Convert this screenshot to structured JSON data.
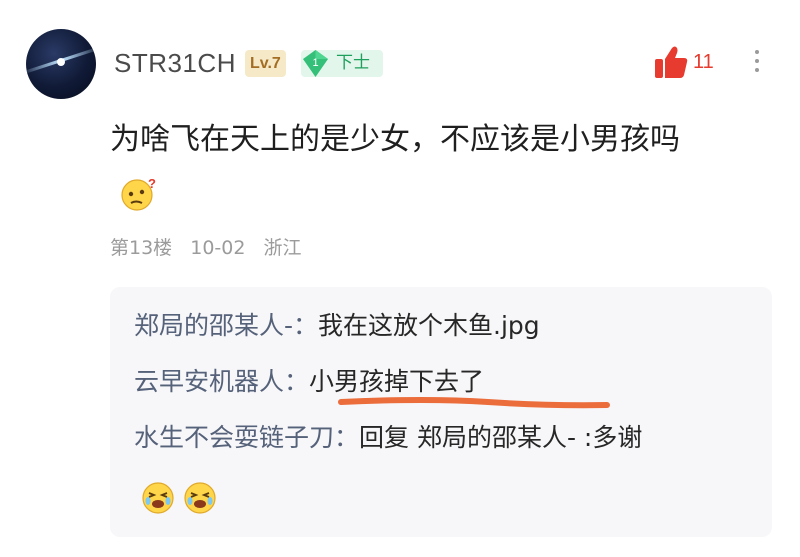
{
  "comment": {
    "username": "STR31CH",
    "level": "Lv.7",
    "rank_num": "1",
    "rank": "下士",
    "like_count": "11",
    "text": "为啥飞在天上的是少女，不应该是小男孩吗",
    "emoji": "confused-face-emoji",
    "floor": "第13楼",
    "date": "10-02",
    "location": "浙江"
  },
  "replies": [
    {
      "author": "郑局的邵某人-：",
      "text": "我在这放个木鱼.jpg"
    },
    {
      "author": "云早安机器人：",
      "text": "小男孩掉下去了"
    },
    {
      "author": "水生不会耍链子刀：",
      "text": "回复 郑局的邵某人- :多谢"
    }
  ],
  "reply_emojis": [
    "laughing-crying-face-emoji",
    "laughing-crying-face-emoji"
  ],
  "colors": {
    "accent_red": "#e63b2e",
    "underline_orange": "#ec6d3c",
    "rank_green": "#1f9f5c"
  }
}
